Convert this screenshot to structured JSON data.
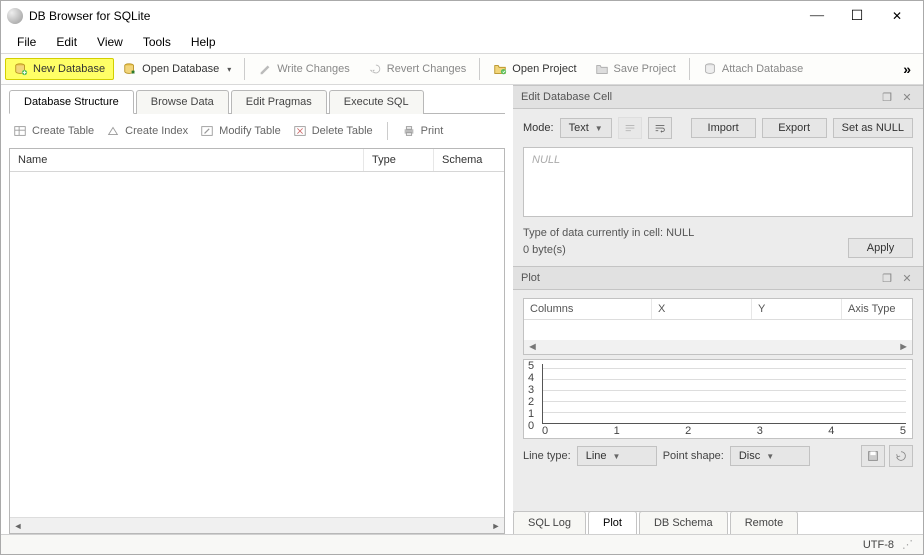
{
  "app": {
    "title": "DB Browser for SQLite"
  },
  "window_controls": {
    "min": "—",
    "max": "☐",
    "close": "✕"
  },
  "menubar": [
    "File",
    "Edit",
    "View",
    "Tools",
    "Help"
  ],
  "toolbar": {
    "new_db": "New Database",
    "open_db": "Open Database",
    "write_changes": "Write Changes",
    "revert_changes": "Revert Changes",
    "open_project": "Open Project",
    "save_project": "Save Project",
    "attach_db": "Attach Database",
    "overflow": "»"
  },
  "left_tabs": {
    "structure": "Database Structure",
    "browse": "Browse Data",
    "pragmas": "Edit Pragmas",
    "sql": "Execute SQL"
  },
  "structure_toolbar": {
    "create_table": "Create Table",
    "create_index": "Create Index",
    "modify_table": "Modify Table",
    "delete_table": "Delete Table",
    "print": "Print"
  },
  "tree_headers": {
    "name": "Name",
    "type": "Type",
    "schema": "Schema"
  },
  "edit_cell": {
    "title": "Edit Database Cell",
    "mode_label": "Mode:",
    "mode_value": "Text",
    "import": "Import",
    "export": "Export",
    "set_null": "Set as NULL",
    "cell_placeholder": "NULL",
    "type_info": "Type of data currently in cell: NULL",
    "size_info": "0 byte(s)",
    "apply": "Apply"
  },
  "plot": {
    "title": "Plot",
    "cols": {
      "columns": "Columns",
      "x": "X",
      "y": "Y",
      "axis_type": "Axis Type"
    },
    "line_type_label": "Line type:",
    "line_type_value": "Line",
    "point_shape_label": "Point shape:",
    "point_shape_value": "Disc"
  },
  "chart_data": {
    "type": "line",
    "x": [
      0,
      1,
      2,
      3,
      4,
      5
    ],
    "y_ticks": [
      0,
      1,
      2,
      3,
      4,
      5
    ],
    "series": [],
    "xlabel": "",
    "ylabel": "",
    "xlim": [
      0,
      5
    ],
    "ylim": [
      0,
      5
    ]
  },
  "bottom_tabs": {
    "sql_log": "SQL Log",
    "plot": "Plot",
    "db_schema": "DB Schema",
    "remote": "Remote"
  },
  "statusbar": {
    "encoding": "UTF-8"
  }
}
